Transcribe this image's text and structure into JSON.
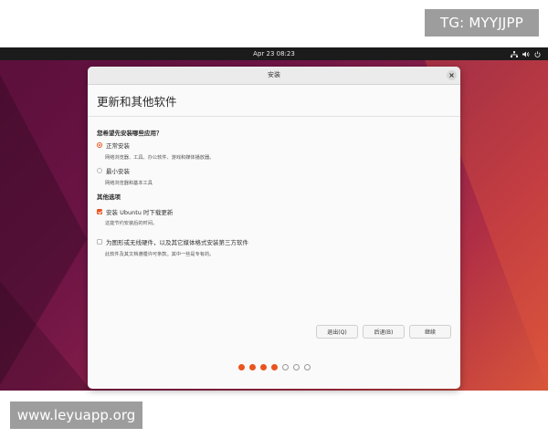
{
  "watermarks": {
    "top": "TG: MYYJJPP",
    "bottom": "www.leyuapp.org"
  },
  "topbar": {
    "clock": "Apr 23  08:23",
    "tray_icons": [
      "network-icon",
      "volume-icon",
      "power-icon"
    ]
  },
  "window": {
    "title": "安装",
    "close_icon": "close-icon"
  },
  "page": {
    "heading": "更新和其他软件",
    "question": "您希望先安装哪些应用？",
    "options": [
      {
        "label": "正常安装",
        "description": "网络浏览器、工具、办公软件、游戏和媒体播放器。",
        "selected": true
      },
      {
        "label": "最小安装",
        "description": "网络浏览器和基本工具",
        "selected": false
      }
    ],
    "other_section_title": "其他选项",
    "checkboxes": [
      {
        "label": "安装 Ubuntu 时下载更新",
        "description": "这能节约安装后的时间。",
        "checked": true
      },
      {
        "label": "为图形或无线硬件，以及其它媒体格式安装第三方软件",
        "description": "此软件及其文档遵循许可条款。其中一些是专有的。",
        "checked": false
      }
    ]
  },
  "buttons": {
    "quit": "退出(Q)",
    "back": "后退(B)",
    "continue": "继续"
  },
  "progress": {
    "current_step": 4,
    "total_steps": 7
  },
  "colors": {
    "accent": "#e95420",
    "topbar": "#1b1b1b",
    "window_bg": "#fafafa"
  }
}
